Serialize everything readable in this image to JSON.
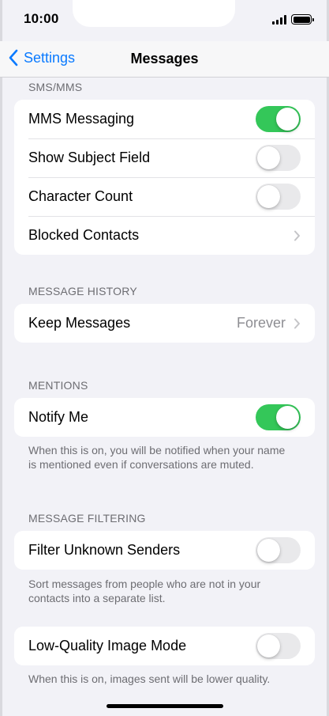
{
  "status_bar": {
    "time": "10:00"
  },
  "nav": {
    "back_label": "Settings",
    "title": "Messages"
  },
  "colors": {
    "accent": "#0a7aff",
    "toggle_on": "#34c759",
    "toggle_off": "#e9e9eb"
  },
  "sections": {
    "sms": {
      "header": "SMS/MMS",
      "rows": [
        {
          "label": "MMS Messaging",
          "toggle": "on"
        },
        {
          "label": "Show Subject Field",
          "toggle": "off"
        },
        {
          "label": "Character Count",
          "toggle": "off"
        },
        {
          "label": "Blocked Contacts",
          "icon": "chevron-right-icon"
        }
      ]
    },
    "history": {
      "header": "MESSAGE HISTORY",
      "rows": [
        {
          "label": "Keep Messages",
          "value": "Forever",
          "icon": "chevron-right-icon"
        }
      ]
    },
    "mentions": {
      "header": "MENTIONS",
      "rows": [
        {
          "label": "Notify Me",
          "toggle": "on"
        }
      ],
      "footnote": "When this is on, you will be notified when your name is mentioned even if conversations are muted."
    },
    "filtering": {
      "header": "MESSAGE FILTERING",
      "rows": [
        {
          "label": "Filter Unknown Senders",
          "toggle": "off"
        }
      ],
      "footnote": "Sort messages from people who are not in your contacts into a separate list."
    },
    "low_quality": {
      "rows": [
        {
          "label": "Low-Quality Image Mode",
          "toggle": "off"
        }
      ],
      "footnote": "When this is on, images sent will be lower quality."
    }
  }
}
